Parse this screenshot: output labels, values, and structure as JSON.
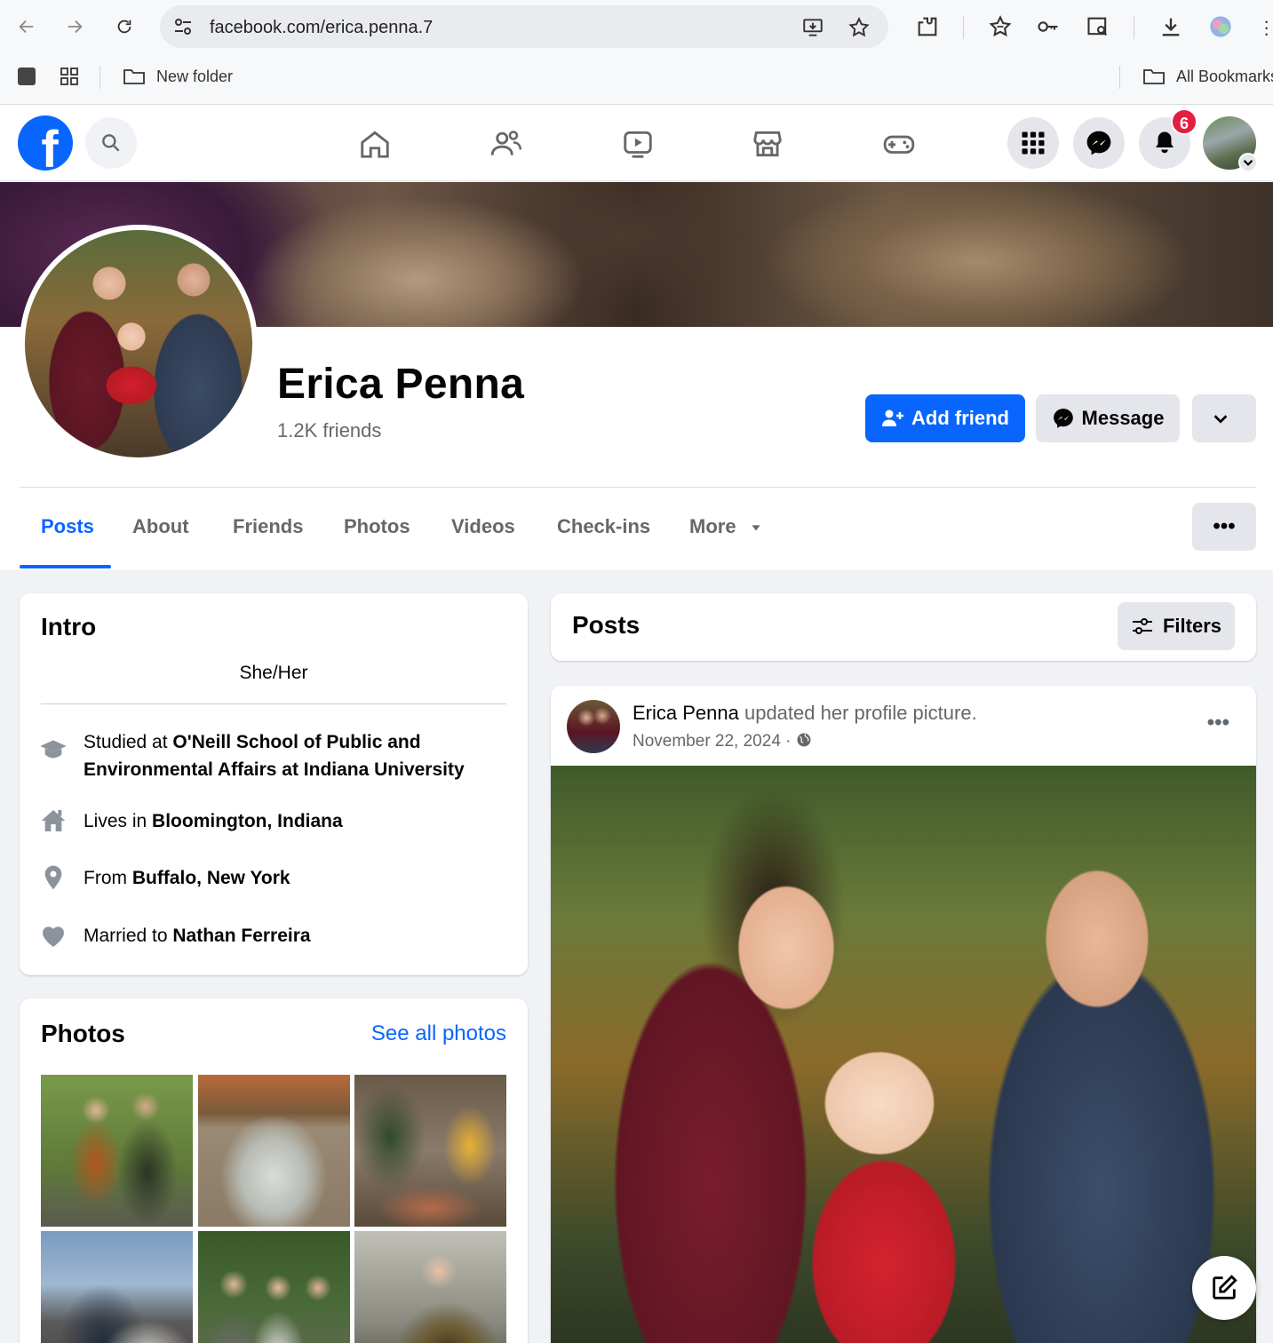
{
  "browser": {
    "url": "facebook.com/erica.penna.7",
    "bookmarks": {
      "folder": "New folder",
      "all_bookmarks": "All Bookmarks"
    }
  },
  "fb_nav": {
    "logo": "f",
    "tabs": [
      "home-icon",
      "friends-icon",
      "watch-icon",
      "marketplace-icon",
      "gaming-icon"
    ],
    "notification_count": "6"
  },
  "profile": {
    "name": "Erica Penna",
    "friends": "1.2K friends",
    "add_friend_label": "Add friend",
    "message_label": "Message"
  },
  "tabs": {
    "items": [
      "Posts",
      "About",
      "Friends",
      "Photos",
      "Videos",
      "Check-ins",
      "More"
    ],
    "active": "Posts",
    "more_dots": "•••"
  },
  "intro": {
    "title": "Intro",
    "pronouns": "She/Her",
    "studied_prefix": "Studied at ",
    "studied_school": "O'Neill School of Public and Environmental Affairs at Indiana University",
    "lives_prefix": "Lives in ",
    "lives_place": "Bloomington, Indiana",
    "from_prefix": "From ",
    "from_place": "Buffalo, New York",
    "married_prefix": "Married to ",
    "married_name": "Nathan Ferreira"
  },
  "photos": {
    "title": "Photos",
    "see_all": "See all photos"
  },
  "posts_section": {
    "title": "Posts",
    "filters_label": "Filters"
  },
  "post": {
    "author": "Erica Penna",
    "action": " updated her profile picture.",
    "date": "November 22, 2024 · ",
    "menu": "•••"
  }
}
